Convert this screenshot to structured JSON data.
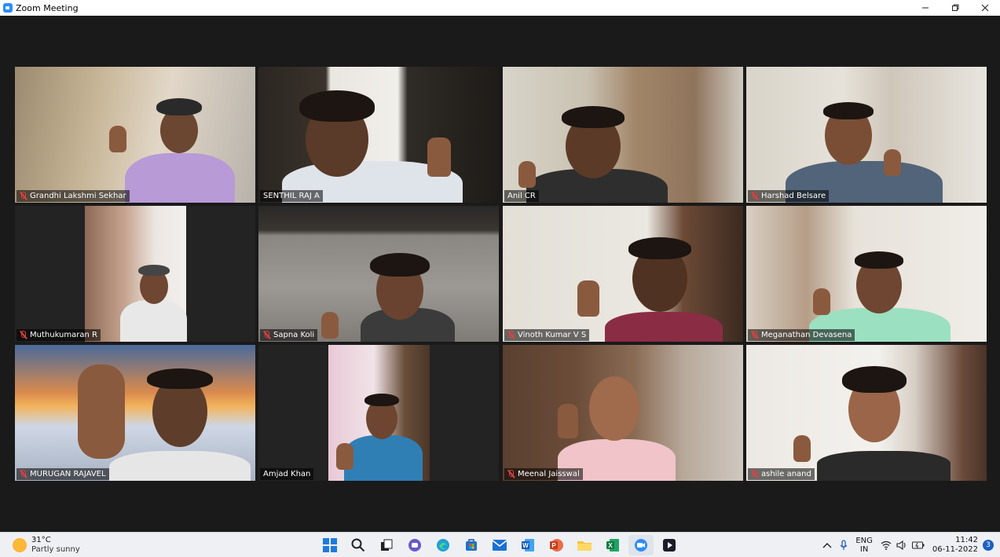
{
  "window": {
    "title": "Zoom Meeting"
  },
  "participants": [
    {
      "name": "Grandhi Lakshmi Sekhar",
      "muted": true,
      "active": false
    },
    {
      "name": "SENTHIL RAJ A",
      "muted": false,
      "active": true
    },
    {
      "name": "Anil CR",
      "muted": false,
      "active": false
    },
    {
      "name": "Harshad Belsare",
      "muted": true,
      "active": false
    },
    {
      "name": "Muthukumaran R",
      "muted": true,
      "active": false
    },
    {
      "name": "Sapna Koli",
      "muted": true,
      "active": false
    },
    {
      "name": "Vinoth Kumar V S",
      "muted": true,
      "active": false
    },
    {
      "name": "Meganathan Devasena",
      "muted": true,
      "active": false
    },
    {
      "name": "MURUGAN RAJAVEL",
      "muted": true,
      "active": false
    },
    {
      "name": "Amjad Khan",
      "muted": false,
      "active": false
    },
    {
      "name": "Meenal Jaisswal",
      "muted": true,
      "active": false
    },
    {
      "name": "ashile anand",
      "muted": true,
      "active": false
    }
  ],
  "taskbar": {
    "weather": {
      "temp": "31°C",
      "desc": "Partly sunny",
      "icon": "sun-icon"
    },
    "apps": [
      {
        "name": "start-icon"
      },
      {
        "name": "search-icon"
      },
      {
        "name": "task-view-icon"
      },
      {
        "name": "teams-chat-icon"
      },
      {
        "name": "edge-icon"
      },
      {
        "name": "store-icon"
      },
      {
        "name": "mail-icon"
      },
      {
        "name": "word-icon"
      },
      {
        "name": "powerpoint-icon"
      },
      {
        "name": "file-explorer-icon"
      },
      {
        "name": "excel-icon"
      },
      {
        "name": "zoom-icon"
      },
      {
        "name": "media-player-icon"
      }
    ],
    "tray": {
      "lang_top": "ENG",
      "lang_bottom": "IN",
      "time": "11:42",
      "date": "06-11-2022",
      "notifications": "3"
    }
  },
  "colors": {
    "active_speaker": "#d9e85a",
    "muted_icon": "#e04040",
    "zoom_blue": "#2d8cff"
  }
}
